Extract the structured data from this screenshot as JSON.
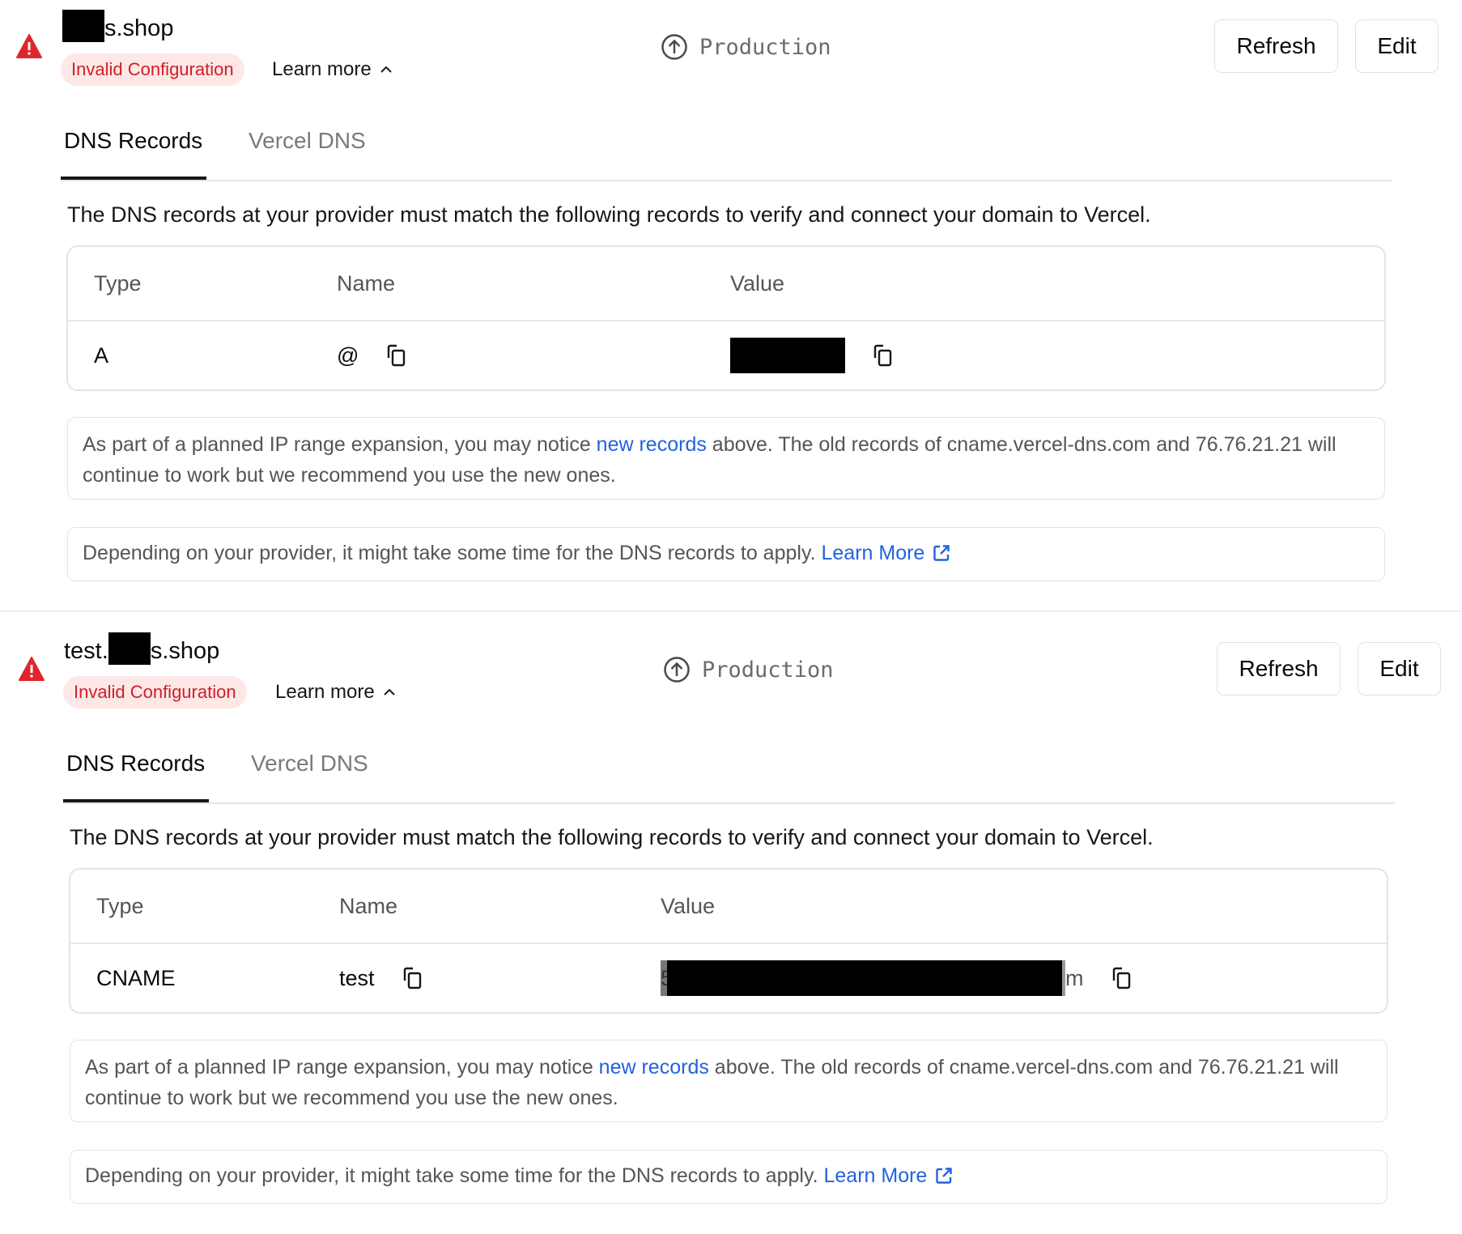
{
  "domains": [
    {
      "name_suffix": "s.shop",
      "name_prefix": "",
      "status_badge": "Invalid Configuration",
      "learn_more": "Learn more",
      "environment": "Production",
      "refresh_label": "Refresh",
      "edit_label": "Edit",
      "tabs": [
        "DNS Records",
        "Vercel DNS"
      ],
      "description": "The DNS records at your provider must match the following records to verify and connect your domain to Vercel.",
      "table_headers": [
        "Type",
        "Name",
        "Value"
      ],
      "record": {
        "type": "A",
        "name": "@",
        "value": ""
      },
      "note_part1": "As part of a planned IP range expansion, you may notice ",
      "note_link": "new records",
      "note_part2": " above. The old records of cname.vercel-dns.com and 76.76.21.21 will continue to work but we recommend you use the new ones.",
      "apply_text": "Depending on your provider, it might take some time for the DNS records to apply. ",
      "apply_link": "Learn More"
    },
    {
      "name_prefix": "test.",
      "name_suffix": "s.shop",
      "status_badge": "Invalid Configuration",
      "learn_more": "Learn more",
      "environment": "Production",
      "refresh_label": "Refresh",
      "edit_label": "Edit",
      "tabs": [
        "DNS Records",
        "Vercel DNS"
      ],
      "description": "The DNS records at your provider must match the following records to verify and connect your domain to Vercel.",
      "table_headers": [
        "Type",
        "Name",
        "Value"
      ],
      "record": {
        "type": "CNAME",
        "name": "test",
        "value_start": "5",
        "value_end": "m"
      },
      "note_part1": "As part of a planned IP range expansion, you may notice ",
      "note_link": "new records",
      "note_part2": " above. The old records of cname.vercel-dns.com and 76.76.21.21 will continue to work but we recommend you use the new ones.",
      "apply_text": "Depending on your provider, it might take some time for the DNS records to apply. ",
      "apply_link": "Learn More"
    }
  ],
  "colors": {
    "error_red": "#e0262b",
    "badge_bg": "#fde7e7",
    "link_blue": "#2262e0"
  }
}
